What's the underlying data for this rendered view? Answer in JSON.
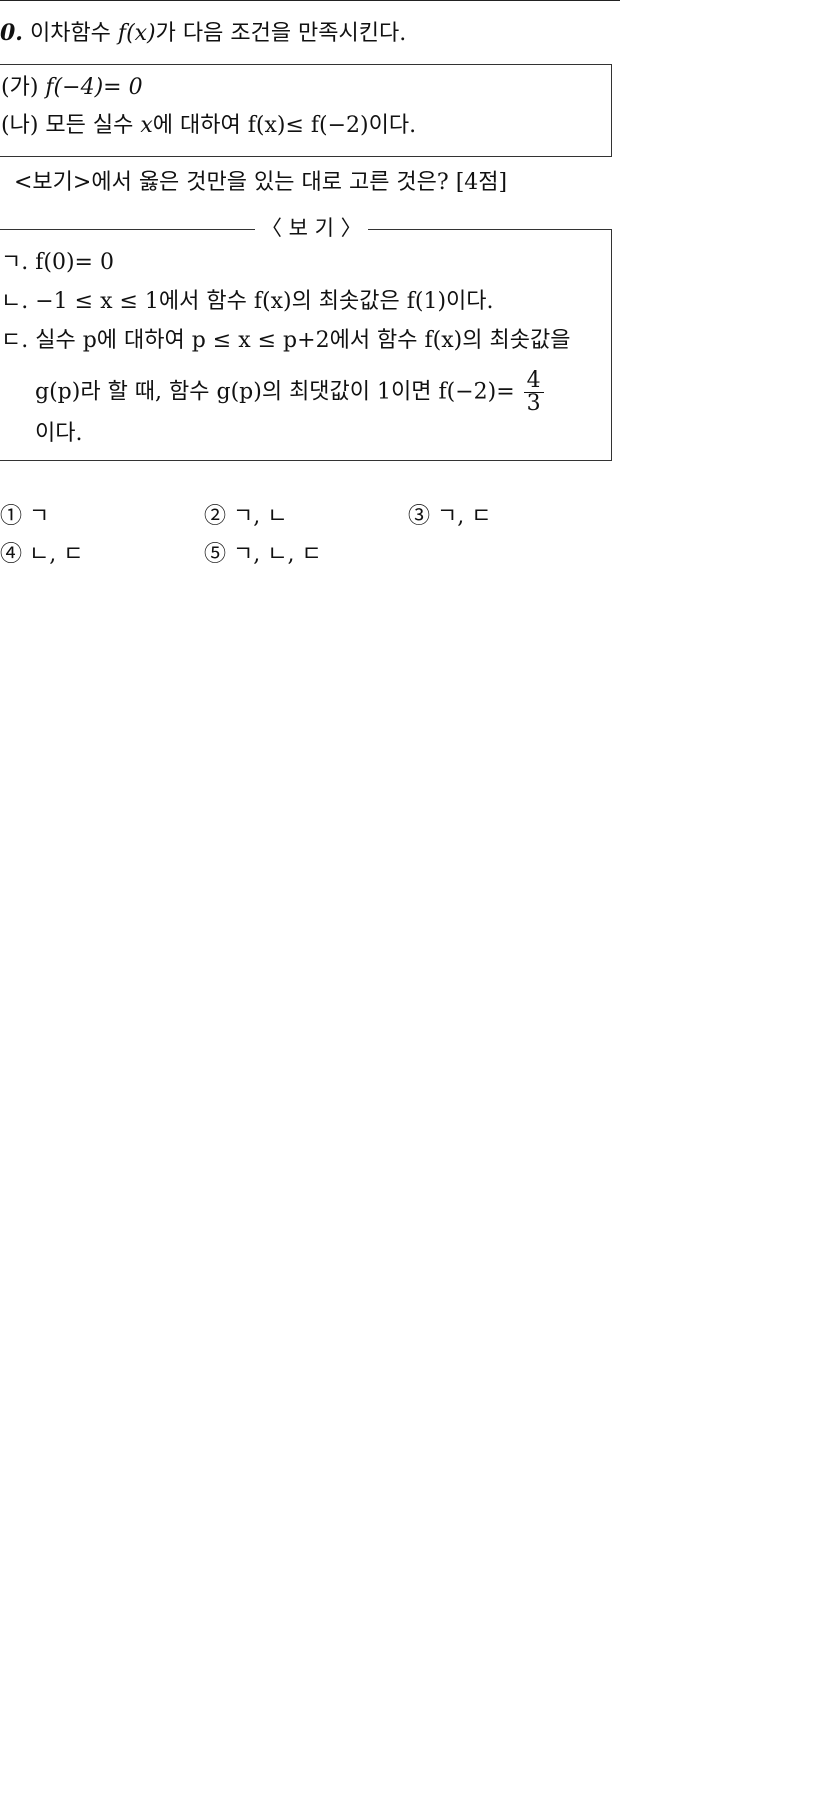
{
  "question": {
    "number": "0.",
    "stem_a": " 이차함수 ",
    "stem_fx": "f(x)",
    "stem_b": "가 다음 조건을 만족시킨다."
  },
  "conditions": [
    {
      "label": "(가) ",
      "math": "f(−4)= 0",
      "tail": ""
    },
    {
      "label": "(나) 모든 실수 ",
      "math": "x",
      "tail": "에 대하여 f(x)≤ f(−2)이다."
    }
  ],
  "instruction": "<보기>에서 옳은 것만을 있는 대로 고른 것은? [4점]",
  "bogi": {
    "title": "〈 보 기 〉",
    "items": {
      "a": "ㄱ. f(0)= 0",
      "b": "ㄴ. −1 ≤ x ≤ 1에서 함수 f(x)의 최솟값은 f(1)이다.",
      "c_line1": "ㄷ. 실수 p에 대하여 p ≤ x ≤ p+2에서 함수 f(x)의 최솟값을",
      "c_line2": "g(p)라 할 때, 함수 g(p)의 최댓값이 1이면 f(−2)= ",
      "c_frac_num": "4",
      "c_frac_den": "3",
      "c_line3": "이다."
    }
  },
  "choices": [
    "① ㄱ",
    "② ㄱ, ㄴ",
    "③ ㄱ, ㄷ",
    "④ ㄴ, ㄷ",
    "⑤ ㄱ, ㄴ, ㄷ"
  ]
}
